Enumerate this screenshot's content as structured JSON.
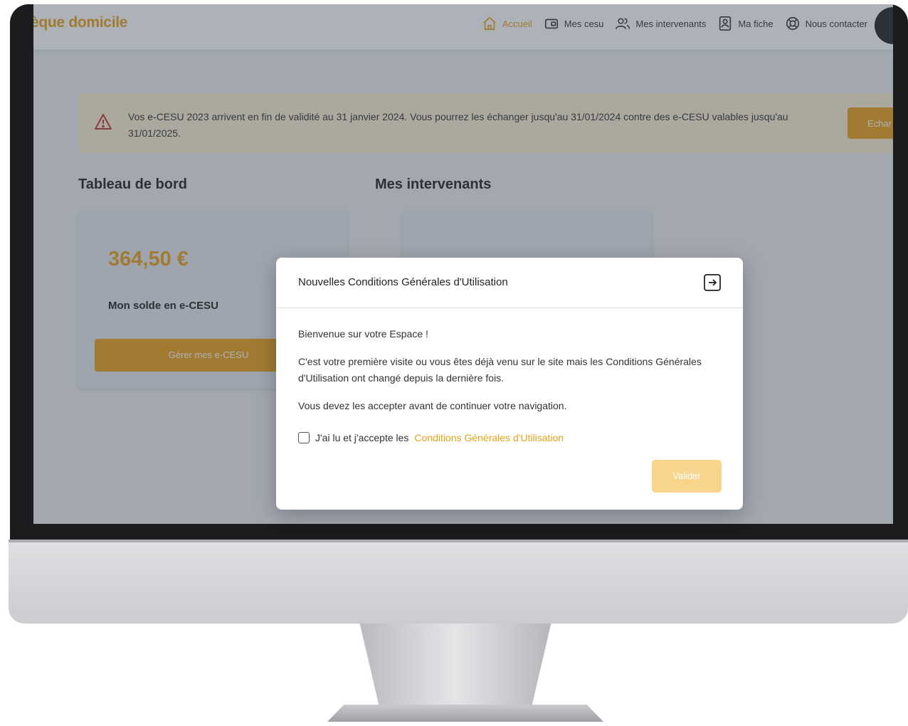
{
  "header": {
    "logo": "èque domicile",
    "nav": [
      {
        "label": "Accueil",
        "icon": "home-icon",
        "active": true
      },
      {
        "label": "Mes cesu",
        "icon": "wallet-icon",
        "active": false
      },
      {
        "label": "Mes intervenants",
        "icon": "users-icon",
        "active": false
      },
      {
        "label": "Ma fiche",
        "icon": "id-card-icon",
        "active": false
      },
      {
        "label": "Nous contacter",
        "icon": "lifebuoy-icon",
        "active": false
      }
    ]
  },
  "alert": {
    "text": "Vos e-CESU 2023 arrivent en fin de validité au 31 janvier 2024. Vous pourrez les échanger jusqu'au 31/01/2024 contre des e-CESU valables jusqu'au 31/01/2025.",
    "button": "Echar"
  },
  "dashboard": {
    "title": "Tableau de bord",
    "amount": "364,50 €",
    "label": "Mon solde en e-CESU",
    "button": "Gérer mes e-CESU"
  },
  "intervenants": {
    "title": "Mes intervenants"
  },
  "modal": {
    "title": "Nouvelles Conditions Générales d'Utilisation",
    "greeting": "Bienvenue sur votre Espace !",
    "paragraph1": "C'est votre première visite ou vous êtes déjà venu sur le site mais les Conditions Générales d'Utilisation ont changé depuis la dernière fois.",
    "paragraph2": "Vous devez les accepter avant de continuer votre navigation.",
    "consent_prefix": "J'ai lu et j'accepte les",
    "consent_link": "Conditions Générales d'Utilisation",
    "submit": "Valider"
  },
  "colors": {
    "accent": "#e8a317",
    "alert_bg": "#fbefd2",
    "disabled_button": "#f8d48d"
  }
}
